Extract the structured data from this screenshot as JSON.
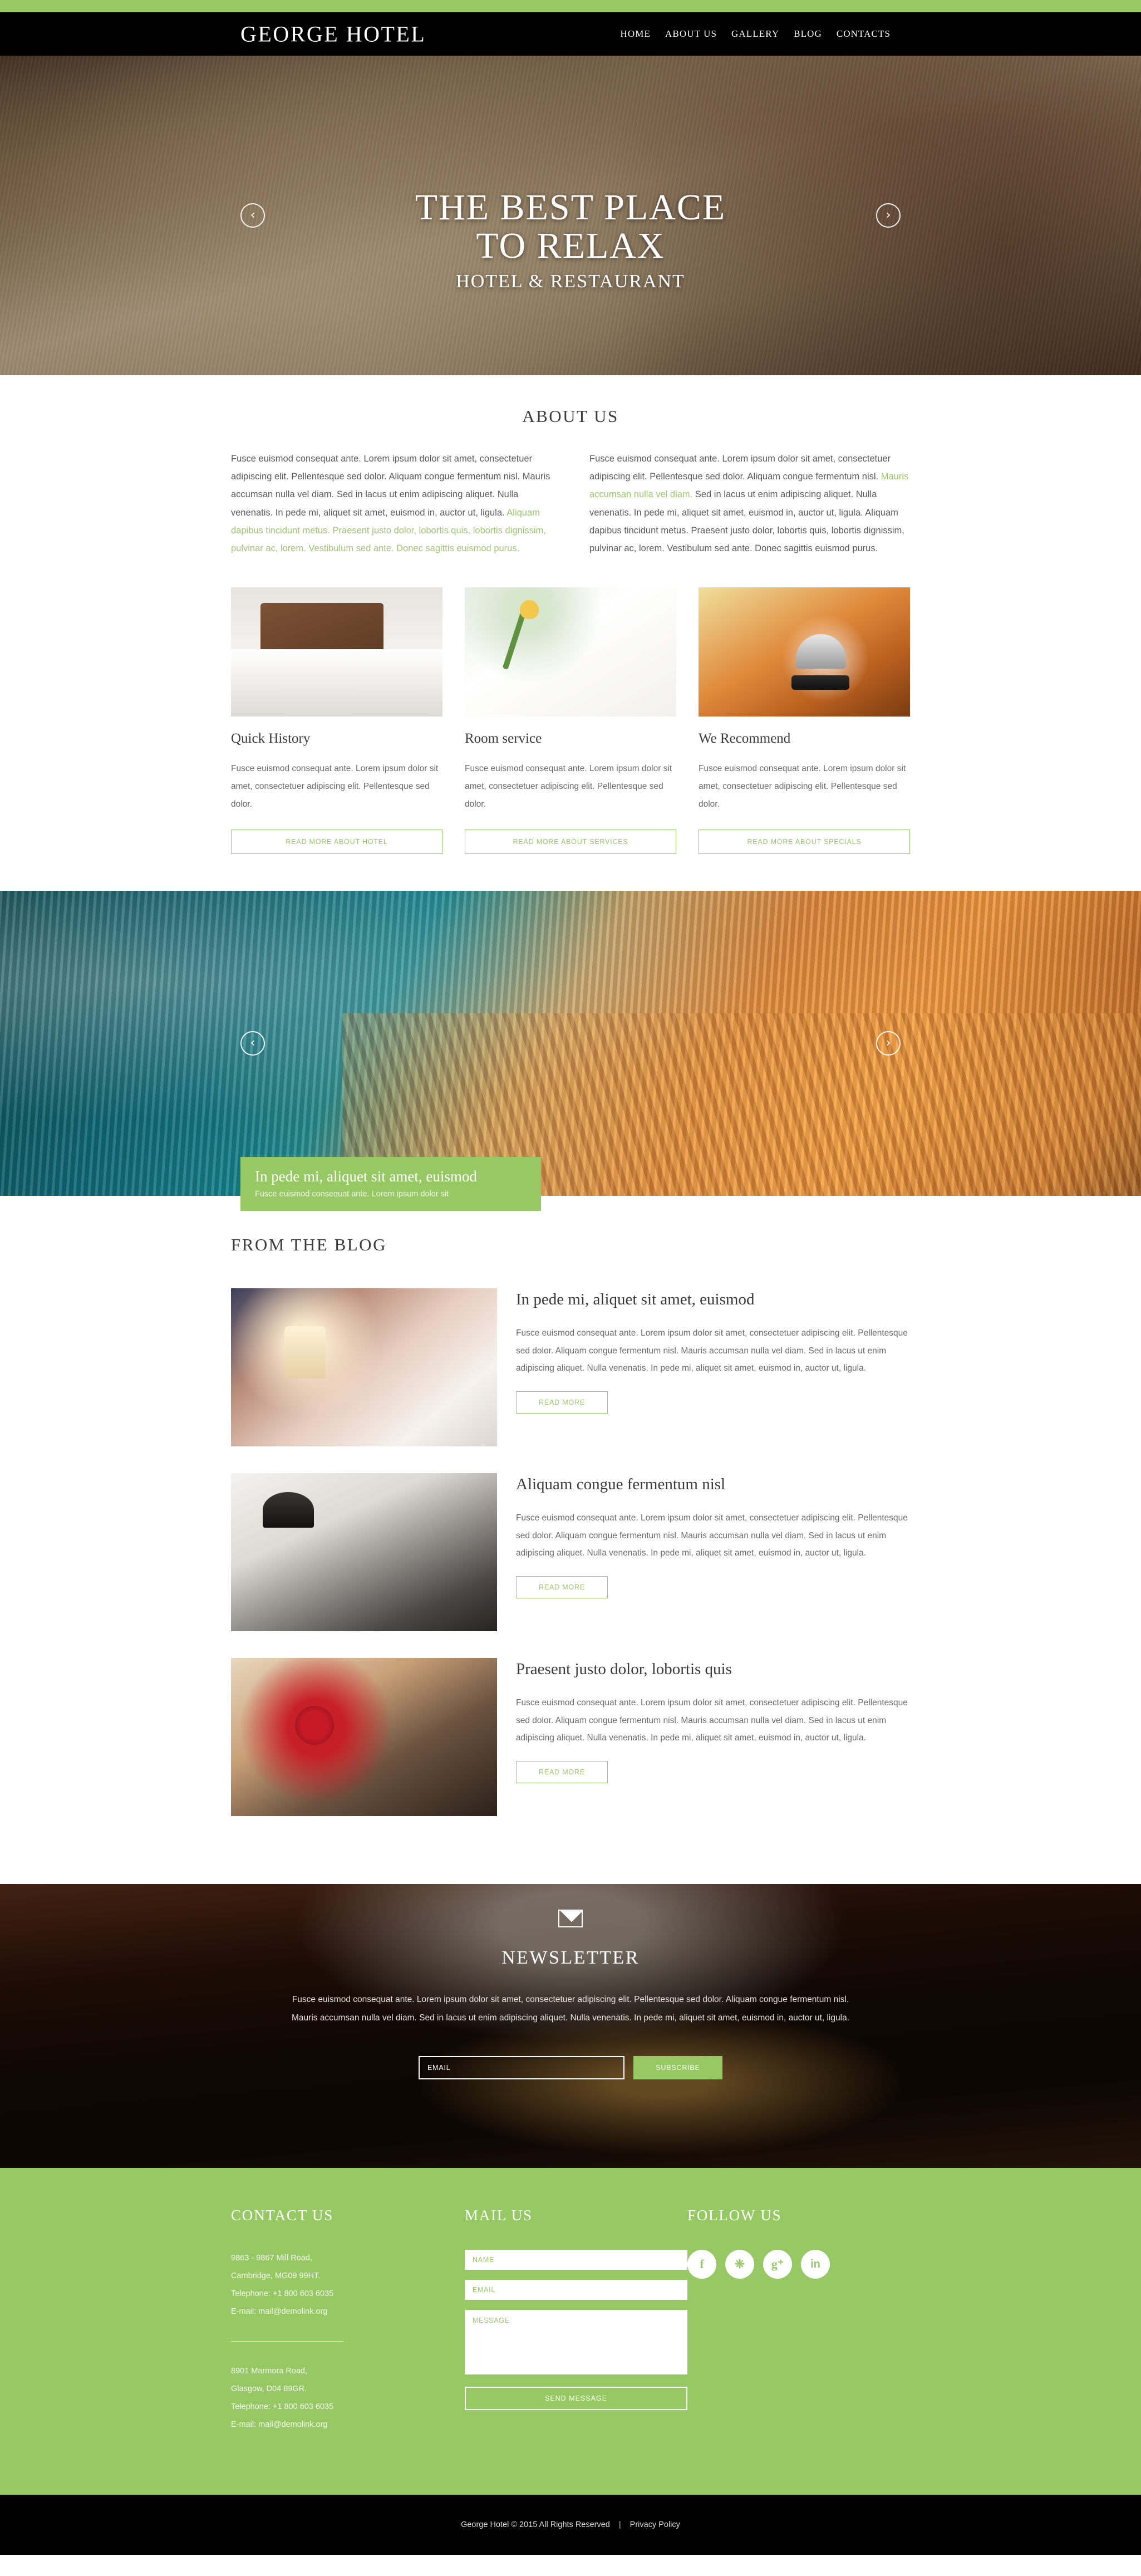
{
  "theme": {
    "accent": "#96c864",
    "dark": "#000000",
    "text": "#5a5a5a"
  },
  "header": {
    "brand": "GEORGE HOTEL",
    "nav": [
      {
        "label": "HOME",
        "active": true
      },
      {
        "label": "ABOUT US",
        "active": false
      },
      {
        "label": "GALLERY",
        "active": false
      },
      {
        "label": "BLOG",
        "active": false
      },
      {
        "label": "CONTACTS",
        "active": false
      }
    ]
  },
  "hero": {
    "line1": "THE BEST PLACE",
    "line2": "TO RELAX",
    "line3": "HOTEL & RESTAURANT",
    "prev_icon": "chevron-left-icon",
    "next_icon": "chevron-right-icon",
    "prev_glyph": "‹",
    "next_glyph": "›"
  },
  "about": {
    "title": "ABOUT US",
    "col_left": {
      "plain_1": "Fusce euismod consequat ante. Lorem ipsum dolor sit amet, consectetuer adipiscing elit. Pellentesque sed dolor. Aliquam congue fermentum nisl. Mauris accumsan nulla vel diam. Sed in lacus ut enim adipiscing aliquet. Nulla venenatis. In pede mi, aliquet sit amet, euismod in, auctor ut, ligula. ",
      "highlight": "Aliquam dapibus tincidunt metus. Praesent justo dolor, lobortis quis, lobortis dignissim, pulvinar ac, lorem. Vestibulum sed ante. Donec sagittis euismod purus."
    },
    "col_right": {
      "plain_1": "Fusce euismod consequat ante. Lorem ipsum dolor sit amet, consectetuer adipiscing elit. Pellentesque sed dolor. Aliquam congue fermentum nisl. ",
      "highlight": "Mauris accumsan nulla vel diam.",
      "plain_2": " Sed in lacus ut enim adipiscing aliquet. Nulla venenatis. In pede mi, aliquet sit amet, euismod in, auctor ut, ligula. Aliquam dapibus tincidunt metus. Praesent justo dolor, lobortis quis, lobortis dignissim, pulvinar ac, lorem. Vestibulum sed ante. Donec sagittis euismod purus."
    },
    "cards": [
      {
        "image_name": "hotel-bed-photo",
        "title": "Quick History",
        "text": "Fusce euismod consequat ante. Lorem ipsum dolor sit amet, consectetuer adipiscing elit. Pellentesque sed dolor.",
        "button": "READ MORE ABOUT  HOTEL"
      },
      {
        "image_name": "towels-rose-photo",
        "title": "Room service",
        "text": "Fusce euismod consequat ante. Lorem ipsum dolor sit amet, consectetuer adipiscing elit. Pellentesque sed dolor.",
        "button": "READ MORE ABOUT  SERVICES"
      },
      {
        "image_name": "reception-bell-photo",
        "title": "We Recommend",
        "text": "Fusce euismod consequat ante. Lorem ipsum dolor sit amet, consectetuer adipiscing elit. Pellentesque sed dolor.",
        "button": "READ MORE ABOUT  SPECIALS"
      }
    ]
  },
  "pool_slider": {
    "image_name": "pool-deck-sunset-photo",
    "caption_title": "In pede mi, aliquet sit amet, euismod",
    "caption_text": "Fusce euismod consequat ante. Lorem ipsum dolor sit",
    "prev_glyph": "‹",
    "next_glyph": "›"
  },
  "blog": {
    "title": "FROM THE BLOG",
    "posts": [
      {
        "image_name": "white-lounge-photo",
        "title": "In pede mi, aliquet sit amet, euismod",
        "text": "Fusce euismod consequat ante. Lorem ipsum dolor sit amet, consectetuer adipiscing elit. Pellentesque sed dolor. Aliquam congue fermentum nisl. Mauris accumsan nulla vel diam. Sed in lacus ut enim adipiscing aliquet. Nulla venenatis. In pede mi, aliquet sit amet, euismod in, auctor ut, ligula.",
        "button": "READ MORE"
      },
      {
        "image_name": "bedside-lamp-photo",
        "title": "Aliquam congue fermentum nisl",
        "text": "Fusce euismod consequat ante. Lorem ipsum dolor sit amet, consectetuer adipiscing elit. Pellentesque sed dolor. Aliquam congue fermentum nisl. Mauris accumsan nulla vel diam. Sed in lacus ut enim adipiscing aliquet. Nulla venenatis. In pede mi, aliquet sit amet, euismod in, auctor ut, ligula.",
        "button": "READ MORE"
      },
      {
        "image_name": "red-roses-photo",
        "title": "Praesent justo dolor, lobortis quis",
        "text": "Fusce euismod consequat ante. Lorem ipsum dolor sit amet, consectetuer adipiscing elit. Pellentesque sed dolor. Aliquam congue fermentum nisl. Mauris accumsan nulla vel diam. Sed in lacus ut enim adipiscing aliquet. Nulla venenatis. In pede mi, aliquet sit amet, euismod in, auctor ut, ligula.",
        "button": "READ MORE"
      }
    ]
  },
  "newsletter": {
    "icon_name": "envelope-icon",
    "title": "NEWSLETTER",
    "text": "Fusce euismod consequat ante. Lorem ipsum dolor sit amet, consectetuer adipiscing elit. Pellentesque sed dolor. Aliquam congue fermentum nisl. Mauris accumsan nulla vel diam. Sed in lacus ut enim adipiscing aliquet. Nulla venenatis. In pede mi, aliquet sit amet, euismod in, auctor ut, ligula.",
    "email_placeholder": "EMAIL",
    "email_value": "",
    "submit_label": "SUBSCRIBE"
  },
  "footer": {
    "contact": {
      "title": "CONTACT US",
      "address1": {
        "line1": "9863 - 9867 Mill Road,",
        "line2": "Cambridge, MG09 99HT.",
        "line3": "Telephone:  +1 800 603 6035",
        "line4": "E-mail: mail@demolink.org"
      },
      "address2": {
        "line1": "8901 Marmora Road,",
        "line2": "Glasgow, D04 89GR.",
        "line3": "Telephone:  +1 800 603 6035",
        "line4": "E-mail: mail@demolink.org"
      }
    },
    "mail": {
      "title": "MAIL US",
      "name_placeholder": "NAME",
      "name_value": "",
      "email_placeholder": "EMAIL",
      "email_value": "",
      "message_placeholder": "MESSAGE",
      "message_value": "",
      "submit_label": "SEND MESSAGE"
    },
    "follow": {
      "title": "FOLLOW US",
      "socials": [
        {
          "icon_name": "facebook-icon",
          "glyph": "f"
        },
        {
          "icon_name": "twitter-icon",
          "glyph": "❈"
        },
        {
          "icon_name": "google-plus-icon",
          "glyph": "g⁺"
        },
        {
          "icon_name": "linkedin-icon",
          "glyph": "in"
        }
      ]
    }
  },
  "bottom": {
    "copyright": "George Hotel © 2015 All Rights Reserved",
    "separator": "|",
    "privacy": "Privacy Policy"
  }
}
